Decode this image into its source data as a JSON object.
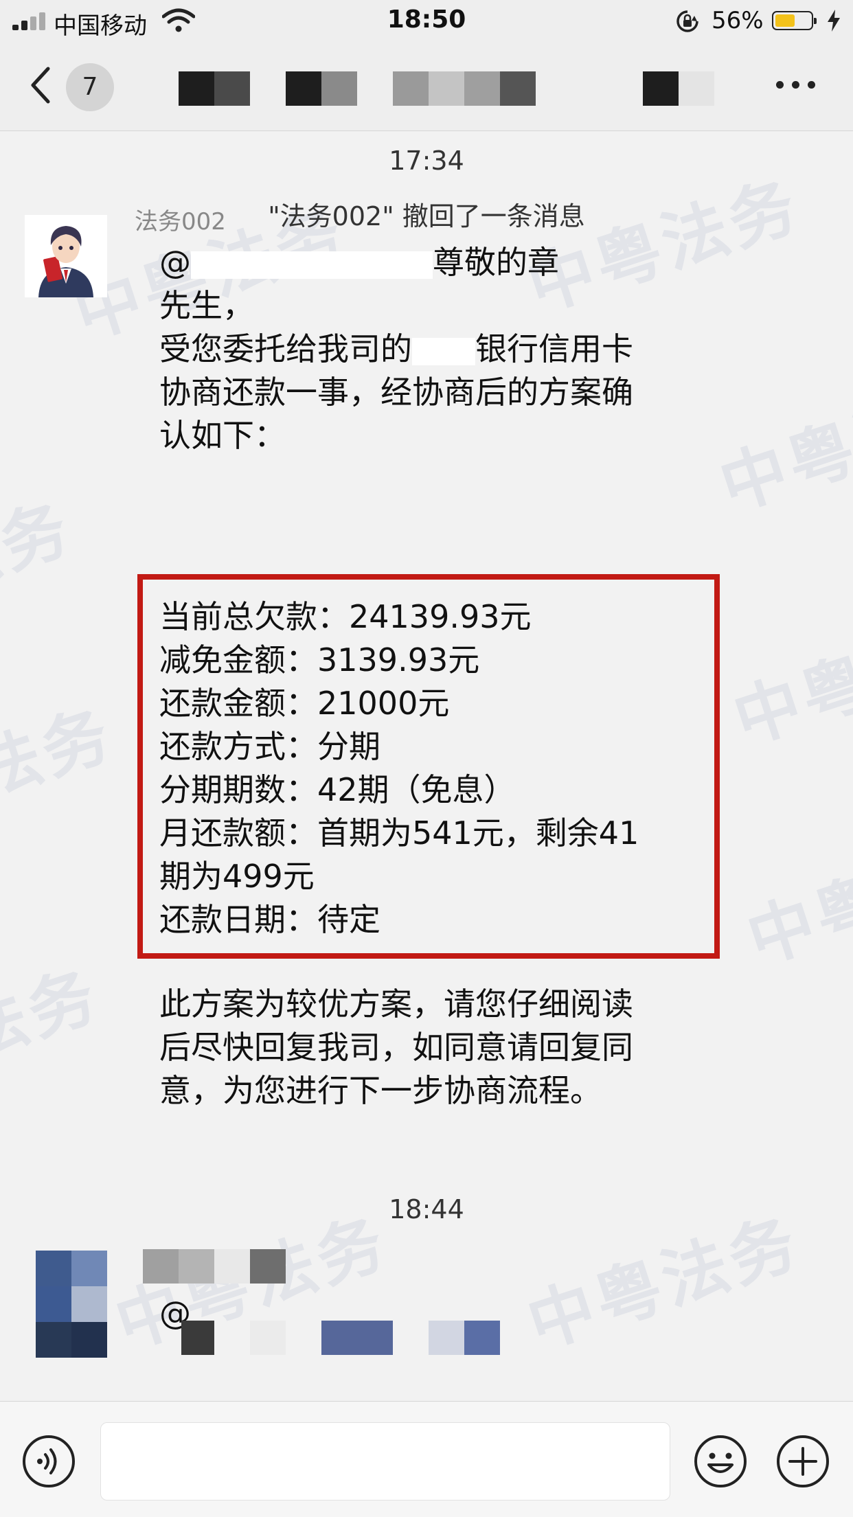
{
  "status_bar": {
    "carrier": "中国移动",
    "time": "18:50",
    "battery_percent": "56%",
    "battery_level": 0.56
  },
  "nav": {
    "unread_count": "7"
  },
  "chat": {
    "messages": [
      {
        "type": "timestamp",
        "text": "17:34"
      },
      {
        "type": "system",
        "text": "\"法务002\" 撤回了一条消息"
      },
      {
        "type": "message",
        "sender": "法务002",
        "intro_lines": [
          {
            "pre": "@",
            "post": "尊敬的章"
          },
          {
            "text": "先生，"
          },
          {
            "pre": "受您委托给我司的",
            "post": "银行信用卡"
          },
          {
            "text": "协商还款一事，经协商后的方案确"
          },
          {
            "text": "认如下："
          }
        ],
        "plan_lines": [
          "当前总欠款：24139.93元",
          "减免金额：3139.93元",
          "还款金额：21000元",
          "还款方式：分期",
          "分期期数：42期（免息）",
          "月还款额：首期为541元，剩余41",
          "期为499元",
          "还款日期：待定"
        ],
        "closing_lines": [
          "此方案为较优方案，请您仔细阅读",
          "后尽快回复我司，如同意请回复同",
          "意，为您进行下一步协商流程。"
        ]
      },
      {
        "type": "timestamp",
        "text": "18:44"
      },
      {
        "type": "message",
        "mention_prefix": "@"
      }
    ]
  },
  "watermark": {
    "text": "中粤法务"
  },
  "icons": {
    "back": "chevron-left-icon",
    "more": "more-dots-icon",
    "voice": "voice-icon",
    "emoji": "emoji-icon",
    "add": "plus-icon"
  },
  "colors": {
    "highlight_border": "#c21a14",
    "battery_fill": "#f3c21b"
  }
}
